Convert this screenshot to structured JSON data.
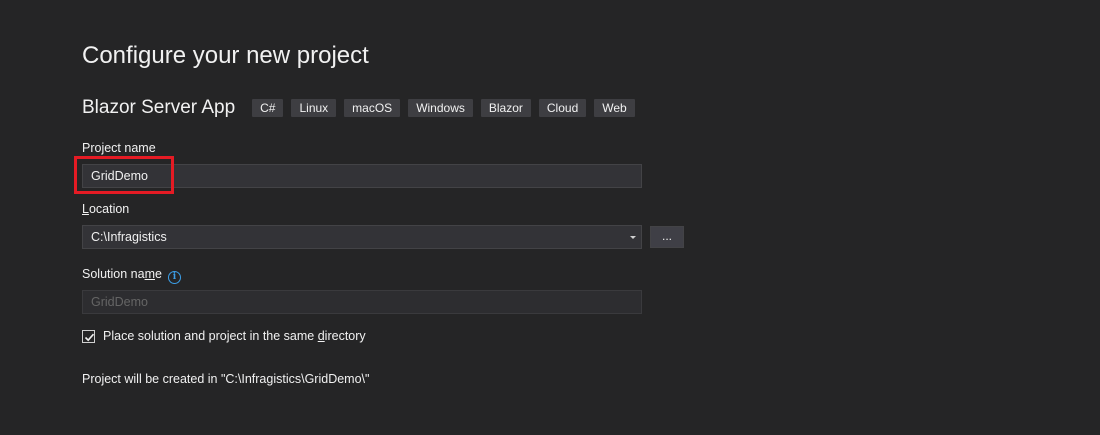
{
  "page_title": "Configure your new project",
  "template": {
    "name": "Blazor Server App",
    "tags": [
      "C#",
      "Linux",
      "macOS",
      "Windows",
      "Blazor",
      "Cloud",
      "Web"
    ]
  },
  "project_name": {
    "label": "Project name",
    "value": "GridDemo"
  },
  "location": {
    "label_prefix": "",
    "label_underlined": "L",
    "label_rest": "ocation",
    "value": "C:\\Infragistics",
    "browse_label": "..."
  },
  "solution_name": {
    "label_prefix": "Solution na",
    "label_underlined": "m",
    "label_rest": "e",
    "placeholder": "GridDemo",
    "info_icon": "info-icon"
  },
  "same_directory": {
    "checked": true,
    "label_prefix": "Place solution and project in the same ",
    "label_underlined": "d",
    "label_rest": "irectory"
  },
  "footer_note": "Project will be created in \"C:\\Infragistics\\GridDemo\\\"",
  "colors": {
    "background": "#252526",
    "highlight": "#e51b24",
    "info_accent": "#3c9fe8"
  }
}
